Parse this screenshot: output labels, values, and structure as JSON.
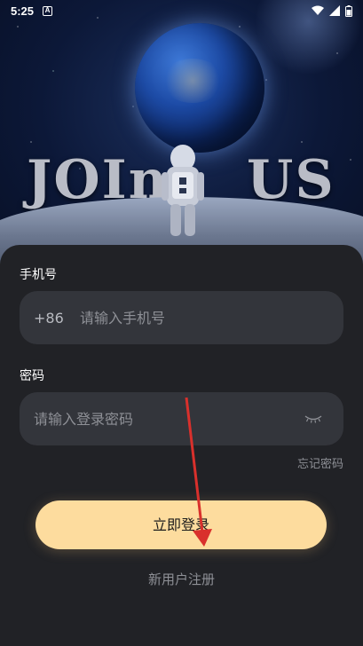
{
  "status_bar": {
    "time": "5:25",
    "notification_icon": "a-icon",
    "right_icons": [
      "wifi-icon",
      "cellular-signal-icon",
      "battery-icon"
    ]
  },
  "hero": {
    "text_left": "JOIn",
    "text_right": "US"
  },
  "form": {
    "phone_label": "手机号",
    "phone_prefix": "+86",
    "phone_placeholder": "请输入手机号",
    "password_label": "密码",
    "password_placeholder": "请输入登录密码",
    "password_toggle_icon": "eye-closed-icon",
    "forgot_password": "忘记密码",
    "login_button": "立即登录",
    "register_link": "新用户注册"
  },
  "colors": {
    "card_bg": "#212226",
    "input_bg": "#33353b",
    "accent": "#fddc9e",
    "annotation_arrow": "#d9302c"
  }
}
